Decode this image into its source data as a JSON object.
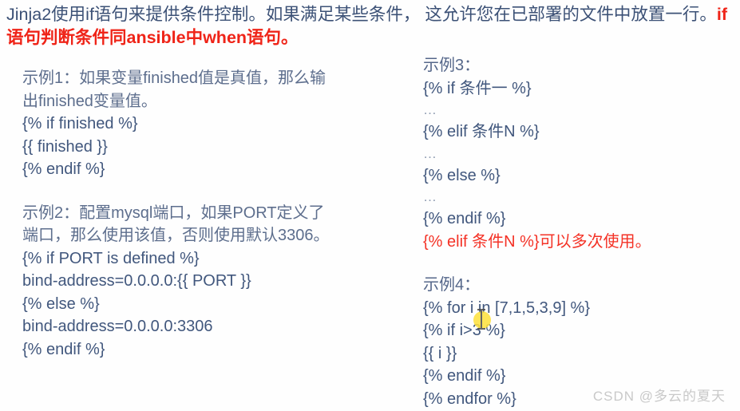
{
  "slide": {
    "background_color": "#fefefe",
    "body_text_color": "#41577d",
    "accent_color": "#ef2418"
  },
  "header": {
    "part1": "Jinja2使用if语句来提供条件控制。如果满足某些条件， 这允许您在已部署的文件中放置一行。",
    "emphasis": "if语句判断条件同ansible中when语句。"
  },
  "left_column": {
    "example1": {
      "prose_line1": "示例1：如果变量finished值是真值，那么输",
      "prose_line2": "出finished变量值。",
      "code": [
        "{% if finished %}",
        "{{ finished }}",
        "{% endif %}"
      ]
    },
    "example2": {
      "prose_line1": "示例2：配置mysql端口，如果PORT定义了",
      "prose_line2": "端口，那么使用该值，否则使用默认3306。",
      "code": [
        "{% if PORT is defined %}",
        "bind-address=0.0.0.0:{{ PORT }}",
        "{% else %}",
        "bind-address=0.0.0.0:3306",
        "{% endif %}"
      ]
    }
  },
  "right_column": {
    "example3": {
      "label": "示例3：",
      "lines": [
        "{% if 条件一 %}",
        "…",
        "{% elif 条件N %}",
        "…",
        "{% else %}",
        "…",
        "{% endif %}"
      ],
      "note": "{% elif 条件N %}可以多次使用。"
    },
    "example4": {
      "label": "示例4：",
      "lines": [
        "{% for i in [7,1,5,3,9] %}",
        "{% if i>3 %}",
        "{{ i }}",
        "{% endif %}",
        "{% endfor %}"
      ]
    }
  },
  "watermark": {
    "text": "CSDN @多云的夏天"
  }
}
